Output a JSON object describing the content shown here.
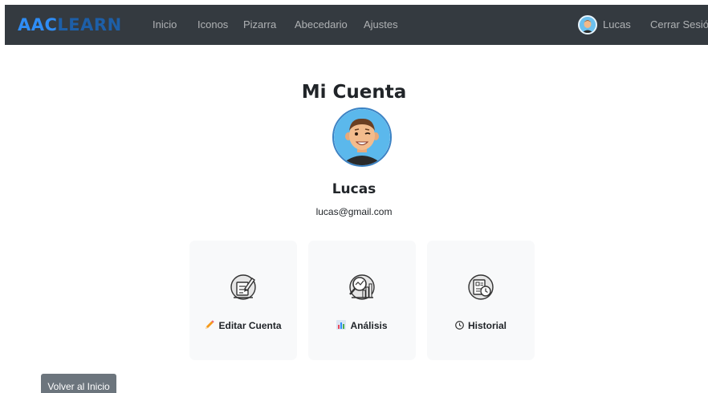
{
  "brand": {
    "part1": "AAC",
    "part2": "LEARN"
  },
  "nav": {
    "items": [
      {
        "label": "Inicio"
      },
      {
        "label": "Iconos"
      },
      {
        "label": "Pizarra"
      },
      {
        "label": "Abecedario"
      },
      {
        "label": "Ajustes"
      }
    ],
    "user_name": "Lucas",
    "logout_label": "Cerrar Sesión"
  },
  "page": {
    "title": "Mi Cuenta",
    "user_name": "Lucas",
    "email": "lucas@gmail.com"
  },
  "cards": [
    {
      "label": "Editar Cuenta",
      "icon": "edit-document-icon",
      "emoji": "pencil-icon"
    },
    {
      "label": "Análisis",
      "icon": "analysis-magnifier-icon",
      "emoji": "bar-chart-icon"
    },
    {
      "label": "Historial",
      "icon": "history-document-icon",
      "emoji": "clock-icon"
    }
  ],
  "back_button": {
    "label": "Volver al Inicio"
  },
  "colors": {
    "navbar": "#343a40",
    "brand_light": "#2f8df5",
    "brand_dark": "#1d5fa8",
    "card_bg": "#f8f9fa",
    "back_button": "#6c757d",
    "avatar_border": "#3b82c4"
  }
}
